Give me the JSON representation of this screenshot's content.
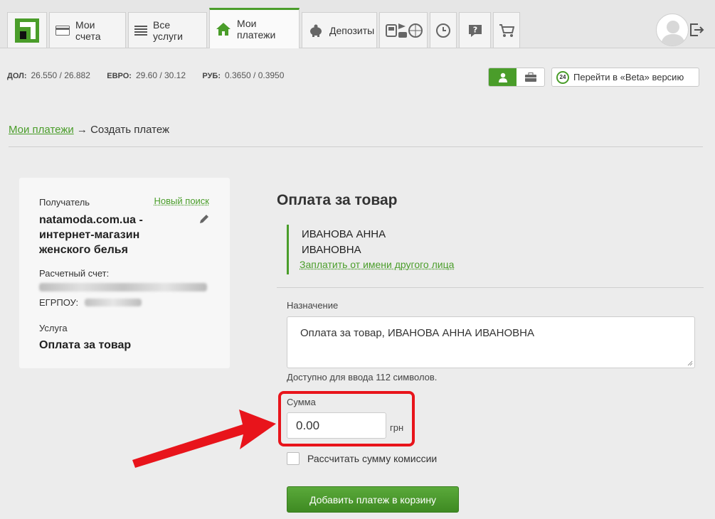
{
  "nav": {
    "tabs": [
      {
        "label": "Мои счета",
        "icon": "card-icon"
      },
      {
        "label": "Все услуги",
        "icon": "list-icon"
      },
      {
        "label": "Мои платежи",
        "icon": "home-icon",
        "active": true
      },
      {
        "label": "Депозиты",
        "icon": "piggy-bank-icon"
      }
    ],
    "icon_tabs": [
      "travel-icon",
      "history-icon",
      "help-icon",
      "cart-icon"
    ]
  },
  "rates": [
    {
      "code": "ДОЛ:",
      "value": "26.550 / 26.882"
    },
    {
      "code": "ЕВРО:",
      "value": "29.60 / 30.12"
    },
    {
      "code": "РУБ:",
      "value": "0.3650 / 0.3950"
    }
  ],
  "beta": {
    "badge": "24",
    "label": "Перейти в «Beta» версию"
  },
  "breadcrumb": {
    "link": "Мои платежи",
    "separator": "→",
    "current": "Создать платеж"
  },
  "recipient_card": {
    "recipient_label": "Получатель",
    "new_search": "Новый поиск",
    "recipient_name": "natamoda.com.ua - интернет-магазин женского белья",
    "account_label": "Расчетный счет:",
    "egrpou_label": "ЕГРПОУ:",
    "service_label": "Услуга",
    "service_name": "Оплата за товар"
  },
  "form": {
    "title": "Оплата за товар",
    "payer_name": "ИВАНОВА АННА ИВАНОВНА",
    "other_payer_link": "Заплатить от имени другого лица",
    "purpose_label": "Назначение",
    "purpose_value": "Оплата за товар, ИВАНОВА АННА ИВАНОВНА",
    "chars_left": "Доступно для ввода 112 символов.",
    "sum_label": "Сумма",
    "sum_value": "0.00",
    "currency": "грн",
    "commission_label": "Рассчитать сумму комиссии",
    "submit_label": "Добавить платеж в корзину"
  },
  "colors": {
    "accent": "#4a9d2a",
    "highlight": "#e8141b"
  }
}
